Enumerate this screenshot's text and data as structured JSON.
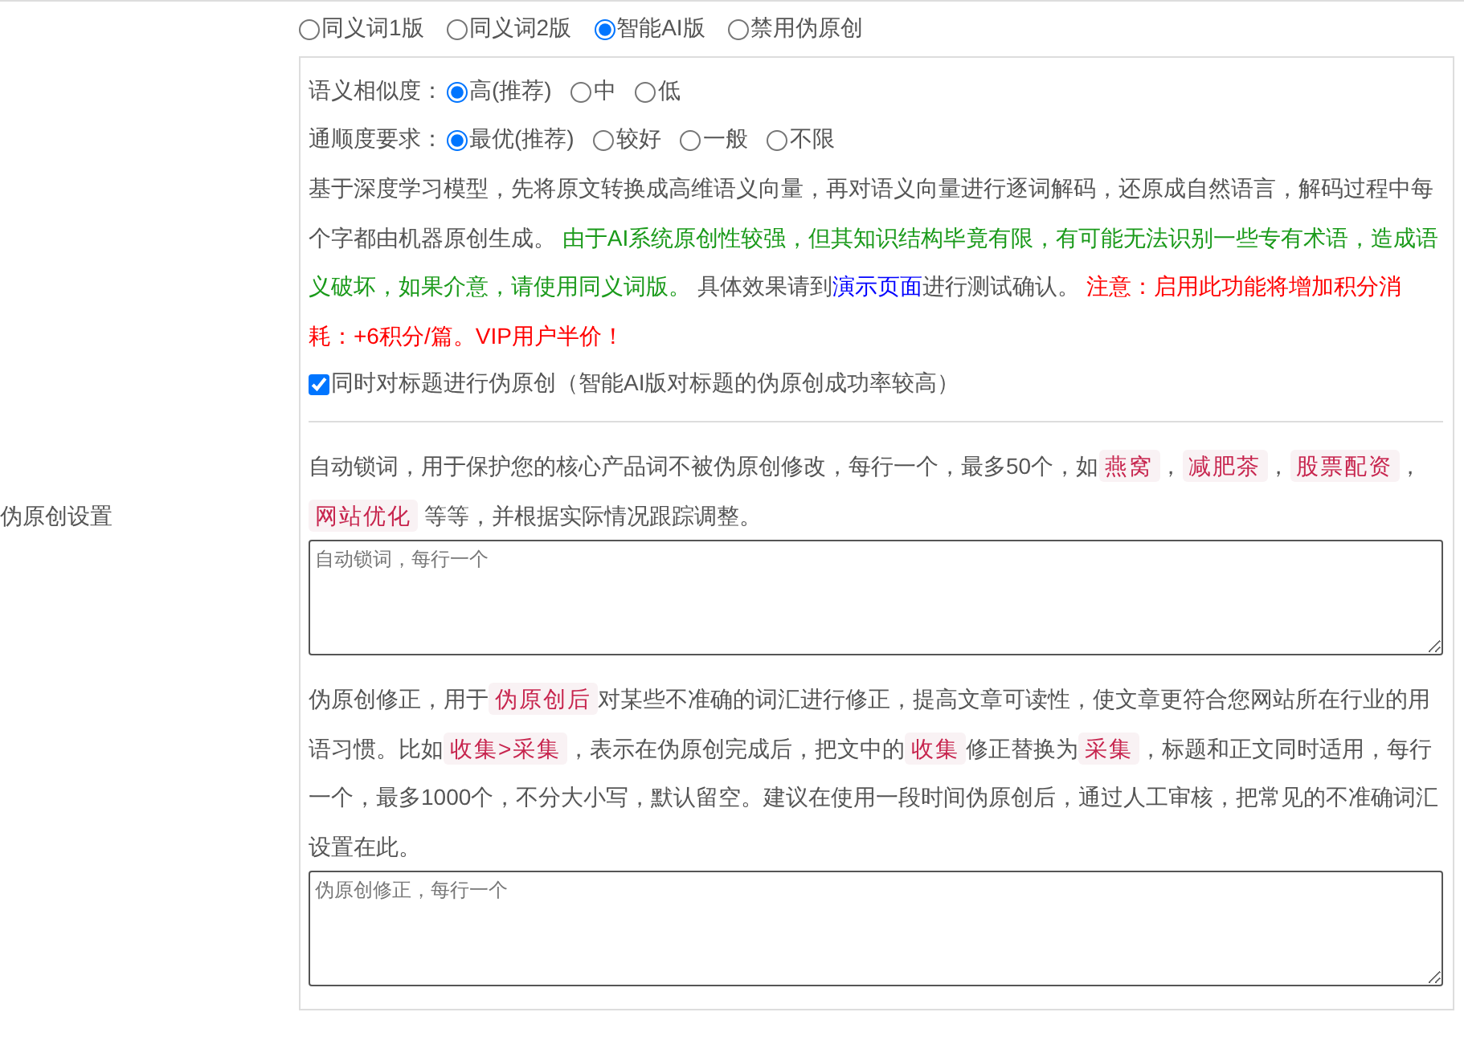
{
  "section_label": "伪原创设置",
  "mode_options": [
    {
      "label": "同义词1版",
      "selected": false
    },
    {
      "label": "同义词2版",
      "selected": false
    },
    {
      "label": "智能AI版",
      "selected": true
    },
    {
      "label": "禁用伪原创",
      "selected": false
    }
  ],
  "ai_panel": {
    "option_groups": [
      {
        "label": "语义相似度：",
        "options": [
          {
            "label": "高(推荐)",
            "selected": true
          },
          {
            "label": "中",
            "selected": false
          },
          {
            "label": "低",
            "selected": false
          }
        ]
      },
      {
        "label": "通顺度要求：",
        "options": [
          {
            "label": "最优(推荐)",
            "selected": true
          },
          {
            "label": "较好",
            "selected": false
          },
          {
            "label": "一般",
            "selected": false
          },
          {
            "label": "不限",
            "selected": false
          }
        ]
      }
    ],
    "description": [
      {
        "kind": "text",
        "text": "基于深度学习模型，先将原文转换成高维语义向量，再对语义向量进行逐词解码，还原成自然语言，解码过程中每个字都由机器原创生成。 "
      },
      {
        "kind": "green",
        "text": "由于AI系统原创性较强，但其知识结构毕竟有限，有可能无法识别一些专有术语，造成语义破坏，如果介意，请使用同义词版。"
      },
      {
        "kind": "text",
        "text": " 具体效果请到"
      },
      {
        "kind": "link",
        "text": "演示页面"
      },
      {
        "kind": "text",
        "text": "进行测试确认。 "
      },
      {
        "kind": "red",
        "text": "注意：启用此功能将增加积分消耗：+6积分/篇。VIP用户半价！"
      }
    ],
    "title_checkbox": {
      "label": "同时对标题进行伪原创（智能AI版对标题的伪原创成功率较高）",
      "checked": true
    }
  },
  "lock_words": {
    "description": [
      {
        "kind": "text",
        "text": "自动锁词，用于保护您的核心产品词不被伪原创修改，每行一个，最多50个，如"
      },
      {
        "kind": "tag",
        "text": "燕窝"
      },
      {
        "kind": "text",
        "text": "，"
      },
      {
        "kind": "tag",
        "text": "减肥茶"
      },
      {
        "kind": "text",
        "text": "，"
      },
      {
        "kind": "tag",
        "text": "股票配资"
      },
      {
        "kind": "text",
        "text": "，"
      },
      {
        "kind": "tag",
        "text": "网站优化"
      },
      {
        "kind": "text",
        "text": " 等等，并根据实际情况跟踪调整。"
      }
    ],
    "placeholder": "自动锁词，每行一个"
  },
  "correction": {
    "description": [
      {
        "kind": "text",
        "text": "伪原创修正，用于"
      },
      {
        "kind": "tag",
        "text": "伪原创后"
      },
      {
        "kind": "text",
        "text": "对某些不准确的词汇进行修正，提高文章可读性，使文章更符合您网站所在行业的用语习惯。比如"
      },
      {
        "kind": "tag",
        "text": "收集>采集"
      },
      {
        "kind": "text",
        "text": "，表示在伪原创完成后，把文中的"
      },
      {
        "kind": "tag",
        "text": "收集"
      },
      {
        "kind": "text",
        "text": "修正替换为"
      },
      {
        "kind": "tag",
        "text": "采集"
      },
      {
        "kind": "text",
        "text": "，标题和正文同时适用，每行一个，最多1000个，不分大小写，默认留空。建议在使用一段时间伪原创后，通过人工审核，把常见的不准确词汇设置在此。"
      }
    ],
    "placeholder": "伪原创修正，每行一个"
  }
}
